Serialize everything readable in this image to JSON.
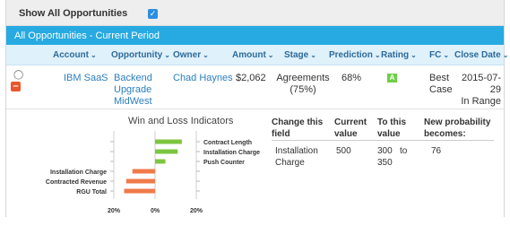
{
  "toolbar": {
    "show_all_label": "Show All Opportunities",
    "show_all_checked": "✓"
  },
  "panel": {
    "title": "All Opportunities  -  Current Period"
  },
  "columns": [
    {
      "label": "Account"
    },
    {
      "label": "Opportunity"
    },
    {
      "label": "Owner"
    },
    {
      "label": "Amount"
    },
    {
      "label": "Stage"
    },
    {
      "label": "Prediction"
    },
    {
      "label": "Rating"
    },
    {
      "label": "FC"
    },
    {
      "label": "Close Date"
    }
  ],
  "caret": "⌄",
  "row": {
    "account": "IBM SaaS",
    "opportunity_lines": [
      "Backend",
      "Upgrade",
      "MidWest"
    ],
    "owner": "Chad Haynes",
    "amount": "$2,062",
    "stage_lines": [
      "Agreements",
      "(75%)"
    ],
    "prediction": "68%",
    "rating": "A",
    "fc_lines": [
      "Best",
      "Case"
    ],
    "close_lines": [
      "2015-07-29",
      "In Range"
    ]
  },
  "chart_data": {
    "type": "bar",
    "orientation": "horizontal",
    "title": "Win and Loss Indicators",
    "categories": [
      "Contract Length",
      "Installation Charge",
      "Push Counter",
      "Installation Charge",
      "Contracted Revenue",
      "RGU Total"
    ],
    "values": [
      0.13,
      0.11,
      0.05,
      -0.11,
      -0.14,
      -0.15
    ],
    "colors": {
      "positive": "#7cc63f",
      "negative": "#f07a4a"
    },
    "xticks": [
      "20%",
      "0%",
      "20%"
    ],
    "xlim": [
      -0.2,
      0.2
    ]
  },
  "whatif": {
    "headers": [
      "Change this field",
      "Current value",
      "To this value",
      "New probability becomes:"
    ],
    "field": "Installation Charge",
    "current": "500",
    "to_from": "300",
    "to_word": "to",
    "to_to": "350",
    "new_prob": "76"
  }
}
